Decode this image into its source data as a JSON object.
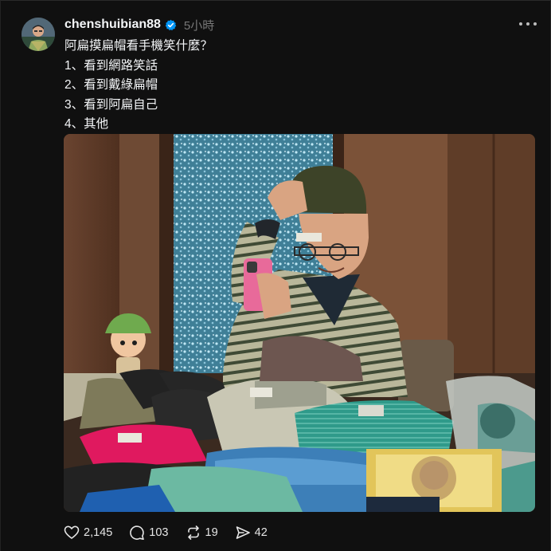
{
  "post": {
    "username": "chenshuibian88",
    "time": "5小時",
    "lines": [
      "阿扁摸扁帽看手機笑什麼？",
      "1、看到網路笑話",
      "2、看到戴綠扁帽",
      "3、看到阿扁自己",
      "4、其他"
    ]
  },
  "photo": {
    "badge_text": ""
  },
  "actions": {
    "likes": "2,145",
    "comments": "103",
    "reposts": "19",
    "shares": "42"
  },
  "icons": [
    "verified-badge-icon",
    "more-options-icon",
    "heart-icon",
    "comment-icon",
    "repost-icon",
    "share-icon"
  ],
  "colors": {
    "background": "#101010",
    "verified": "#0095f6",
    "text": "#f3f5f7",
    "muted": "#777777"
  }
}
